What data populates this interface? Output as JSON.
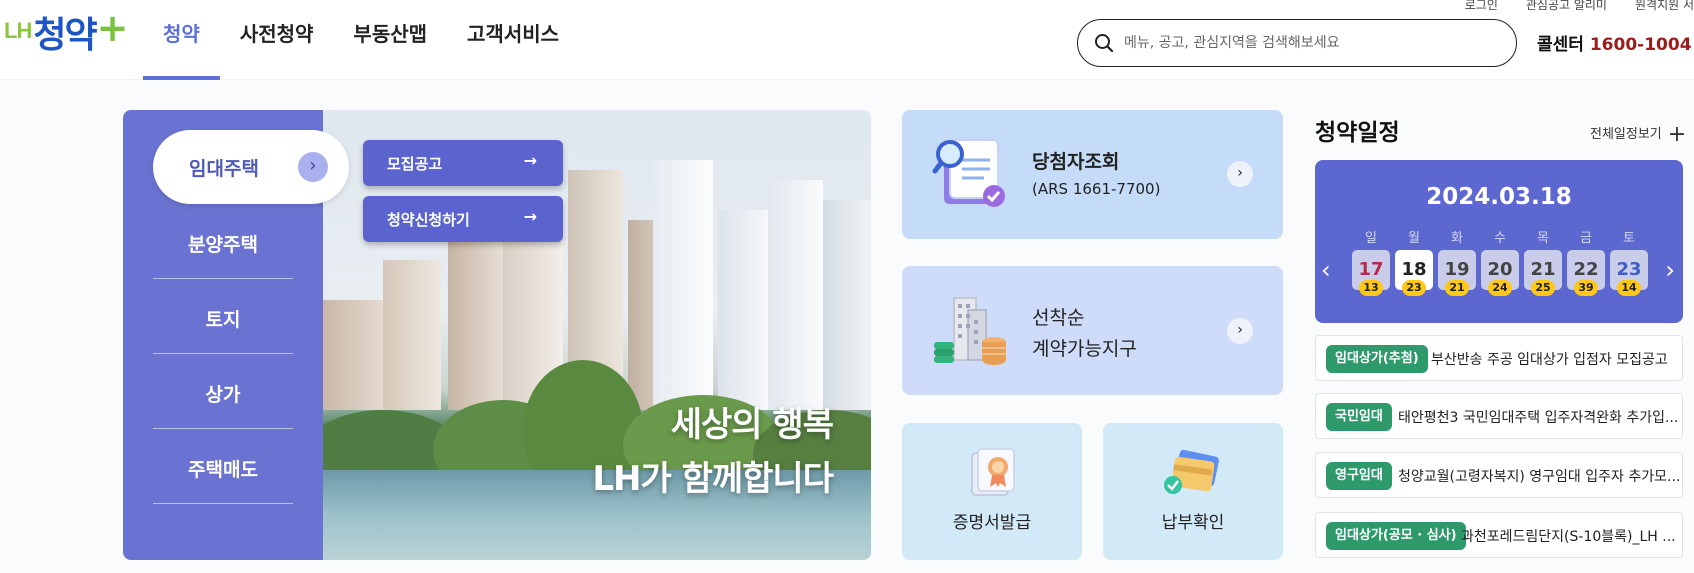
{
  "header": {
    "util_links": [
      "로그인",
      "관심공고 알리미",
      "원격지원 서"
    ],
    "logo": {
      "lh": "LH",
      "main": "청약",
      "plus": "+"
    },
    "nav": [
      "청약",
      "사전청약",
      "부동산맵",
      "고객서비스"
    ],
    "search_placeholder": "메뉴, 공고, 관심지역을 검색해보세요",
    "callcenter_label": "콜센터",
    "callcenter_number": "1600-1004",
    "callcenter_sep": "|"
  },
  "categories": {
    "active": "임대주택",
    "items": [
      "분양주택",
      "토지",
      "상가",
      "주택매도"
    ]
  },
  "banner": {
    "buttons": [
      "모집공고",
      "청약신청하기"
    ],
    "headline_1": "세상의 행복",
    "headline_2": "LH가 함께합니다"
  },
  "cards": {
    "winner": {
      "title": "당첨자조회",
      "sub": "(ARS 1661-7700)"
    },
    "firstcome": {
      "title_1": "선착순",
      "title_2": "계약가능지구"
    },
    "certificate": "증명서발급",
    "payment": "납부확인"
  },
  "schedule": {
    "title": "청약일정",
    "view_all": "전체일정보기",
    "date": "2024.03.18",
    "days": [
      {
        "dow": "일",
        "day": "17",
        "count": "13",
        "type": "sun"
      },
      {
        "dow": "월",
        "day": "18",
        "count": "23",
        "type": "today"
      },
      {
        "dow": "화",
        "day": "19",
        "count": "21",
        "type": ""
      },
      {
        "dow": "수",
        "day": "20",
        "count": "24",
        "type": ""
      },
      {
        "dow": "목",
        "day": "21",
        "count": "25",
        "type": ""
      },
      {
        "dow": "금",
        "day": "22",
        "count": "39",
        "type": ""
      },
      {
        "dow": "토",
        "day": "23",
        "count": "14",
        "type": "sat"
      }
    ],
    "notices": [
      {
        "tag": "임대상가(추첨)",
        "text": "부산반송 주공 임대상가 입점자 모집공고"
      },
      {
        "tag": "국민임대",
        "text": "태안평천3 국민임대주택 입주자격완화 추가입..."
      },
      {
        "tag": "영구임대",
        "text": "청양교월(고령자복지) 영구임대 입주자 추가모..."
      },
      {
        "tag": "임대상가(공모 · 심사)",
        "text": "과천포레드림단지(S-10블록)_LH ..."
      }
    ]
  },
  "colors": {
    "primary": "#5b6fd6",
    "calendar": "#5c67cf",
    "tag": "#2e9a6b",
    "badge": "#ffc819",
    "callcenter": "#9b1c1c"
  }
}
